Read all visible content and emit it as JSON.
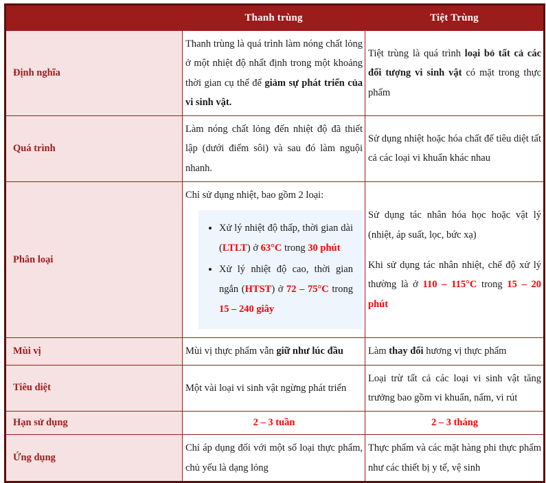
{
  "table": {
    "headers": {
      "label_col": "",
      "col_a": "Thanh trùng",
      "col_b": "Tiệt Trùng"
    },
    "colors": {
      "header_bg": "#9c1b1b",
      "header_text": "#ffffff",
      "label_bg": "#f6e2e2",
      "label_text": "#9e1b1b",
      "border": "#9e1b1b",
      "outer_border": "#5c0d0d",
      "accent_red": "#ff0000",
      "callout_bg": "#eff5fc"
    },
    "rows": [
      {
        "label": "Định nghĩa",
        "a": {
          "parts": [
            {
              "text": "Thanh trùng là quá trình làm nóng chất lỏng ở một nhiệt độ nhất định trong một khoảng thời gian cụ thể để ",
              "style": "normal"
            },
            {
              "text": "giảm sự phát triển của vi sinh vật.",
              "style": "bold"
            }
          ]
        },
        "b": {
          "parts": [
            {
              "text": "Tiệt trùng là quá trình ",
              "style": "normal"
            },
            {
              "text": "loại bỏ tất cả các đối tượng vi sinh vật",
              "style": "bold"
            },
            {
              "text": " có mặt trong thực phẩm",
              "style": "normal"
            }
          ]
        }
      },
      {
        "label": "Quá trình",
        "a": {
          "parts": [
            {
              "text": "Làm nóng chất lỏng đến nhiệt độ đã thiết lập (dưới điểm sôi) và sau đó làm nguội nhanh.",
              "style": "normal"
            }
          ]
        },
        "b": {
          "parts": [
            {
              "text": "Sử dụng nhiệt hoặc hóa chất để tiêu diệt tất cả các loại vi khuẩn khác nhau",
              "style": "normal"
            }
          ]
        }
      },
      {
        "label": "Phân loại",
        "a_intro": "Chỉ sử dụng nhiệt, bao gồm 2 loại:",
        "a_bullets": [
          {
            "parts": [
              {
                "text": "Xử lý nhiệt độ thấp, thời gian dài (",
                "style": "normal"
              },
              {
                "text": "LTLT",
                "style": "red"
              },
              {
                "text": ") ở ",
                "style": "normal"
              },
              {
                "text": "63°C",
                "style": "red"
              },
              {
                "text": " trong ",
                "style": "normal"
              },
              {
                "text": "30 phút",
                "style": "red"
              }
            ]
          },
          {
            "parts": [
              {
                "text": "Xử lý nhiệt độ cao, thời gian ngắn (",
                "style": "normal"
              },
              {
                "text": "HTST",
                "style": "red"
              },
              {
                "text": ") ở ",
                "style": "normal"
              },
              {
                "text": "72 – 75°C",
                "style": "red"
              },
              {
                "text": " trong ",
                "style": "normal"
              },
              {
                "text": "15 – 240 giây",
                "style": "red"
              }
            ]
          }
        ],
        "b_paragraphs": [
          {
            "parts": [
              {
                "text": "Sử dụng tác nhân hóa học hoặc vật lý (nhiệt, áp suất, lọc, bức xạ)",
                "style": "normal"
              }
            ]
          },
          {
            "parts": [
              {
                "text": "Khi sử dụng tác nhân nhiệt, chế độ xử lý thường là ở  ",
                "style": "normal"
              },
              {
                "text": "110 – 115°C",
                "style": "red"
              },
              {
                "text": " trong ",
                "style": "normal"
              },
              {
                "text": "15 – 20 phút",
                "style": "red"
              }
            ]
          }
        ]
      },
      {
        "label": "Mùi vị",
        "a": {
          "parts": [
            {
              "text": "Mùi vị thực phẩm vẫn ",
              "style": "normal"
            },
            {
              "text": "giữ như lúc đầu",
              "style": "bold"
            }
          ]
        },
        "b": {
          "parts": [
            {
              "text": "Làm ",
              "style": "normal"
            },
            {
              "text": "thay đổi",
              "style": "bold"
            },
            {
              "text": " hương vị thực phẩm",
              "style": "normal"
            }
          ]
        }
      },
      {
        "label": "Tiêu diệt",
        "a": {
          "parts": [
            {
              "text": "Một vài loại vi sinh vật ngừng phát triển",
              "style": "normal"
            }
          ]
        },
        "b": {
          "parts": [
            {
              "text": "Loại trừ tất cả các loại vi sinh vật tăng trưởng bao gồm vi khuẩn, nấm, vi rút",
              "style": "normal"
            }
          ]
        }
      },
      {
        "label": "Hạn sử dụng",
        "a": {
          "center": true,
          "parts": [
            {
              "text": "2 – 3 tuần",
              "style": "red"
            }
          ]
        },
        "b": {
          "center": true,
          "parts": [
            {
              "text": "2 – 3 tháng",
              "style": "red"
            }
          ]
        }
      },
      {
        "label": "Ứng dụng",
        "a": {
          "parts": [
            {
              "text": "Chỉ áp dụng đối với một số loại thực phẩm, chủ yếu là dạng lỏng",
              "style": "normal"
            }
          ]
        },
        "b": {
          "parts": [
            {
              "text": "Thực phẩm và các mặt hàng phi thực phẩm như các thiết bị y tế, vệ sinh",
              "style": "normal"
            }
          ]
        }
      }
    ]
  }
}
